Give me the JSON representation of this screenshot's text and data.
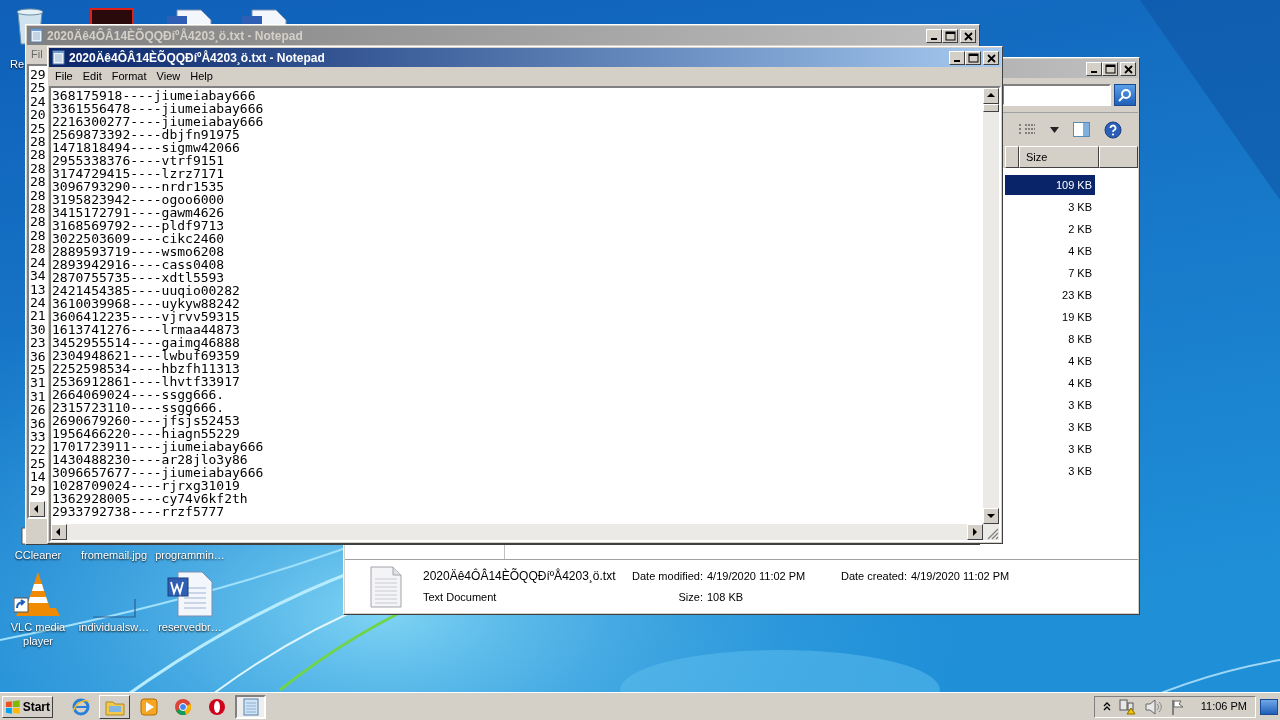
{
  "desktop": {
    "top_icons": [
      {
        "kind": "recycle",
        "label": "Re"
      },
      {
        "kind": "app"
      },
      {
        "kind": "word"
      },
      {
        "kind": "word"
      }
    ],
    "icons": [
      {
        "kind": "ccleaner",
        "label": "CCleaner"
      },
      {
        "kind": "none",
        "label": "fromemail.jpg"
      },
      {
        "kind": "none",
        "label": "programmin…"
      },
      {
        "kind": "vlc",
        "label": "VLC media player"
      },
      {
        "kind": "blank",
        "label": "individualsw…"
      },
      {
        "kind": "word",
        "label": "reservedbr…"
      }
    ]
  },
  "explorer": {
    "active": false,
    "size_header": "Size",
    "rows": [
      {
        "size": "109 KB",
        "selected": true
      },
      {
        "size": "3 KB",
        "selected": false
      },
      {
        "size": "2 KB",
        "selected": false
      },
      {
        "size": "4 KB",
        "selected": false
      },
      {
        "size": "7 KB",
        "selected": false
      },
      {
        "size": "23 KB",
        "selected": false
      },
      {
        "size": "19 KB",
        "selected": false
      },
      {
        "size": "8 KB",
        "selected": false
      },
      {
        "size": "4 KB",
        "selected": false
      },
      {
        "size": "4 KB",
        "selected": false
      },
      {
        "size": "3 KB",
        "selected": false
      },
      {
        "size": "3 KB",
        "selected": false
      },
      {
        "size": "3 KB",
        "selected": false
      },
      {
        "size": "3 KB",
        "selected": false
      }
    ],
    "details": {
      "name": "2020Äê4ÔÂ14ÈÕQQÐíºÅ4203¸ö.txt",
      "type": "Text Document",
      "fields": [
        {
          "label": "Date modified:",
          "value": "4/19/2020 11:02 PM"
        },
        {
          "label": "Size:",
          "value": "108 KB"
        },
        {
          "label": "Date created:",
          "value": "4/19/2020 11:02 PM"
        }
      ]
    }
  },
  "notepad_back": {
    "active": false,
    "title": "2020Äê4ÔÂ14ÈÕQQÐíºÅ4203¸ö.txt - Notepad",
    "menu": [
      "Fil"
    ],
    "lines": [
      "29",
      "25",
      "24",
      "20",
      "25",
      "28",
      "28",
      "28",
      "28",
      "28",
      "28",
      "28",
      "28",
      "28",
      "24",
      "34",
      "13",
      "24",
      "21",
      "30",
      "23",
      "36",
      "25",
      "31",
      "31",
      "26",
      "36",
      "33",
      "22",
      "25",
      "14",
      "29"
    ]
  },
  "notepad": {
    "active": true,
    "title": "2020Äê4ÔÂ14ÈÕQQÐíºÅ4203¸ö.txt - Notepad",
    "menu": [
      "File",
      "Edit",
      "Format",
      "View",
      "Help"
    ],
    "lines": [
      "368175918----jiumeiabay666",
      "3361556478----jiumeiabay666",
      "2216300277----jiumeiabay666",
      "2569873392----dbjfn91975",
      "1471818494----sigmw42066",
      "2955338376----vtrf9151",
      "3174729415----lzrz7171",
      "3096793290----nrdr1535",
      "3195823942----ogoo6000",
      "3415172791----gawm4626",
      "3168569792----pldf9713",
      "3022503609----cikc2460",
      "2889593719----wsmo6208",
      "2893942916----cass0408",
      "2870755735----xdtl5593",
      "2421454385----uuqio00282",
      "3610039968----uykyw88242",
      "3606412235----vjrvv59315",
      "1613741276----lrmaa44873",
      "3452955514----gaimg46888",
      "2304948621----lwbuf69359",
      "2252598534----hbzfh11313",
      "2536912861----lhvtf33917",
      "2664069024----ssgg666.",
      "2315723110----ssgg666.",
      "2690679260----jfsjs52453",
      "1956466220----hiagn55229",
      "1701723911----jiumeiabay666",
      "1430488230----ar28jlo3y86",
      "3096657677----jiumeiabay666",
      "1028709024----rjrxg31019",
      "1362928005----cy74v6kf2th",
      "2933792738----rrzf5777"
    ]
  },
  "taskbar": {
    "start": "Start",
    "apps": [
      {
        "kind": "ie",
        "open": false,
        "active": false
      },
      {
        "kind": "explorer",
        "open": true,
        "active": false
      },
      {
        "kind": "media",
        "open": false,
        "active": false
      },
      {
        "kind": "chrome",
        "open": false,
        "active": false
      },
      {
        "kind": "opera",
        "open": false,
        "active": false
      },
      {
        "kind": "notepad",
        "open": true,
        "active": true
      }
    ],
    "time": "11:06 PM"
  }
}
